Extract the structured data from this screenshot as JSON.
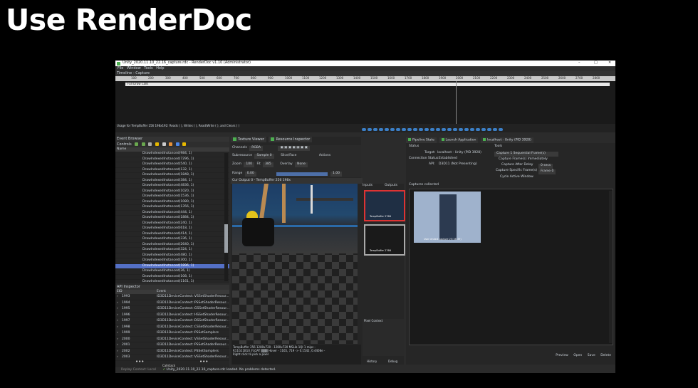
{
  "slide": {
    "title": "Use RenderDoc"
  },
  "window": {
    "title": "Unity_2020.11.10_22.16_capture.rdc - RenderDoc v1.10 (Administrator)",
    "controls": [
      "–",
      "□",
      "✕"
    ]
  },
  "menu": [
    "File",
    "Window",
    "Tools",
    "Help"
  ],
  "timeline": {
    "tab": "Timeline - Capture",
    "ticks": [
      "100",
      "200",
      "300",
      "400",
      "500",
      "600",
      "700",
      "800",
      "900",
      "1000",
      "1100",
      "1200",
      "1300",
      "1400",
      "1500",
      "1600",
      "1700",
      "1800",
      "1900",
      "2000",
      "2100",
      "2200",
      "2300",
      "2400",
      "2500",
      "2600",
      "2700",
      "2800"
    ],
    "row_label": "Full Draw Calls",
    "usage_text": "Usage for TempBuffer 256 198x192: Reads ( ), Writes ( ), Read/Write ( ), and Clears ( )"
  },
  "event_browser": {
    "title": "Event Browser",
    "controls_label": "Controls",
    "column": "Name",
    "rows": [
      "DrawIndexedInstanced(984, 1)",
      "DrawIndexedInstanced(7296, 1)",
      "DrawIndexedInstanced(540, 1)",
      "DrawIndexedInstanced(132, 1)",
      "DrawIndexedInstanced(1848, 1)",
      "DrawIndexedInstanced(384, 1)",
      "DrawIndexedInstanced(4836, 1)",
      "DrawIndexedInstanced(1020, 1)",
      "DrawIndexedInstanced(1536, 1)",
      "DrawIndexedInstanced(1080, 1)",
      "DrawIndexedInstanced(1356, 1)",
      "DrawIndexedInstanced(444, 1)",
      "DrawIndexedInstanced(1884, 1)",
      "DrawIndexedInstanced(240, 1)",
      "DrawIndexedInstanced(618, 1)",
      "DrawIndexedInstanced(414, 1)",
      "DrawIndexedInstanced(336, 1)",
      "DrawIndexedInstanced(2640, 1)",
      "DrawIndexedInstanced(324, 1)",
      "DrawIndexedInstanced(480, 1)",
      "DrawIndexedInstanced(300, 1)",
      "DrawIndexedInstanced(1896, 1)",
      "DrawIndexedInstanced(36, 1)",
      "DrawIndexedInstanced(108, 1)",
      "DrawIndexedInstanced(1161, 1)",
      "DrawIndexedInstanced(2136, 1)",
      "DrawIndexedInstanced(2400, 1)",
      "DrawIndexedInstanced(1848, 1)"
    ],
    "selected_index": 21
  },
  "api_inspector": {
    "title": "API Inspector",
    "columns": [
      "EID",
      "Event"
    ],
    "rows": [
      {
        "eid": "1993",
        "event": "ID3D11DeviceContext::VSSetShaderResour..."
      },
      {
        "eid": "1994",
        "event": "ID3D11DeviceContext::PSSetShaderResour..."
      },
      {
        "eid": "1995",
        "event": "ID3D11DeviceContext::GSSetShaderResour..."
      },
      {
        "eid": "1996",
        "event": "ID3D11DeviceContext::HSSetShaderResour..."
      },
      {
        "eid": "1997",
        "event": "ID3D11DeviceContext::DSSetShaderResour..."
      },
      {
        "eid": "1998",
        "event": "ID3D11DeviceContext::CSSetShaderResour..."
      },
      {
        "eid": "1999",
        "event": "ID3D11DeviceContext::PSSetSamplers"
      },
      {
        "eid": "2000",
        "event": "ID3D11DeviceContext::VSSetShaderResour..."
      },
      {
        "eid": "2001",
        "event": "ID3D11DeviceContext::PSSetShaderResour..."
      },
      {
        "eid": "2002",
        "event": "ID3D11DeviceContext::PSSetSamplers"
      },
      {
        "eid": "2003",
        "event": "ID3D11DeviceContext::VSSetShaderResour..."
      }
    ],
    "dots": "•••",
    "dots2": "•••",
    "caption": "Callstack"
  },
  "texture_viewer": {
    "tabs": [
      "Texture Viewer",
      "Resource Inspector"
    ],
    "channels_label": "Channels",
    "channels_value": "RGBA",
    "subresource_label": "Subresource",
    "subresource_value": "Sample 0",
    "slice_label": "Slice/Face",
    "actions_label": "Actions",
    "zoom_label": "Zoom",
    "zoom_value": "100",
    "fit_label": "Fit",
    "fit_value": "385",
    "overlay_label": "Overlay",
    "overlay_value": "None",
    "range_label": "Range",
    "range_min": "0.00",
    "range_max": "1.00",
    "output_tab": "Cur Output 0 - TempBuffer 256 198x",
    "readout": [
      "TempBuffer 256 1280x720 - 1280x720 MSLib 1Ql 1 mips -",
      "R11G11B10_FLOAT ▒▒▒ Hover -  1165,  719 -> 0.1542, 0.4408e  -",
      "Right click to pick a pixel"
    ]
  },
  "thumbnails": {
    "inputs_label": "Inputs",
    "outputs_label": "Outputs",
    "items": [
      "TempBuffer 2766",
      "TempBuffer 2766"
    ],
    "pixel_context": "Pixel Context",
    "history_button": "History",
    "debug_button": "Debug"
  },
  "right_panel": {
    "tabs": [
      "Pipeline State",
      "Launch Application",
      "localhost - Unity (PID 3928)"
    ],
    "status_label": "Status",
    "tools_label": "Tools",
    "target_label": "Target:",
    "target_value": "localhost - Unity (PID 3928)",
    "connection_label": "Connection Status:",
    "connection_value": "Established",
    "api_label": "API:",
    "api_value": "D3D11 (Not Presenting)",
    "capture_select": "Capture 1 Sequential Frame(s)",
    "capture_now": "Capture Frame(s) Immediately",
    "capture_after_label": "Capture After Delay",
    "capture_after_value": "0 secs",
    "capture_specific_label": "Capture Specific Frame(s)",
    "capture_specific_value": "Frame 0",
    "cycle_label": "Cycle Active Window",
    "captures_collected": "Captures collected",
    "capture_thumb_label": "User ended capture 23:16:39)",
    "buttons": [
      "Preview",
      "Open",
      "Save",
      "Delete"
    ]
  },
  "status_bar": {
    "left": "Replay Context: Local",
    "msg": "Unity_2020.11.10_22.16_capture.rdc loaded. No problems detected."
  },
  "colors": {
    "selected_row": "#5470c6",
    "accent_green": "#4caf50",
    "red_border": "#d33333"
  }
}
